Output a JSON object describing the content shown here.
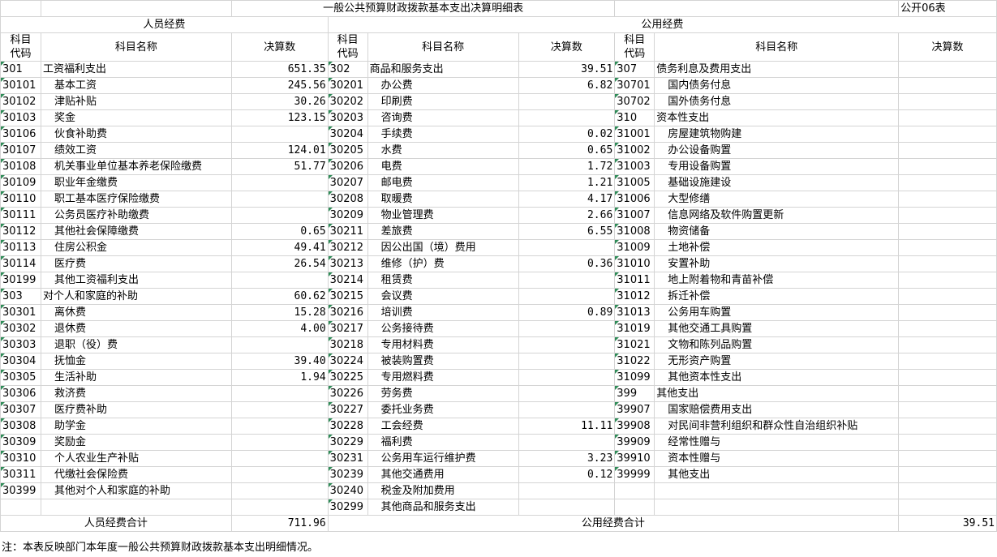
{
  "title": "一般公共预算财政拨款基本支出决算明细表",
  "code_tag": "公开06表",
  "groups": {
    "personnel": "人员经费",
    "public": "公用经费"
  },
  "headers": {
    "code_line1": "科目",
    "code_line2": "代码",
    "name": "科目名称",
    "amount": "决算数"
  },
  "rows": [
    {
      "c1": "301",
      "n1": "工资福利支出",
      "a1": "651.35",
      "c2": "302",
      "n2": "商品和服务支出",
      "a2": "39.51",
      "c3": "307",
      "n3": "债务利息及费用支出",
      "a3": ""
    },
    {
      "c1": "30101",
      "n1": "基本工资",
      "a1": "245.56",
      "c2": "30201",
      "n2": "办公费",
      "a2": "6.82",
      "c3": "30701",
      "n3": "国内债务付息",
      "a3": ""
    },
    {
      "c1": "30102",
      "n1": "津贴补贴",
      "a1": "30.26",
      "c2": "30202",
      "n2": "印刷费",
      "a2": "",
      "c3": "30702",
      "n3": "国外债务付息",
      "a3": ""
    },
    {
      "c1": "30103",
      "n1": "奖金",
      "a1": "123.15",
      "c2": "30203",
      "n2": "咨询费",
      "a2": "",
      "c3": "310",
      "n3": "资本性支出",
      "a3": ""
    },
    {
      "c1": "30106",
      "n1": "伙食补助费",
      "a1": "",
      "c2": "30204",
      "n2": "手续费",
      "a2": "0.02",
      "c3": "31001",
      "n3": "房屋建筑物购建",
      "a3": ""
    },
    {
      "c1": "30107",
      "n1": "绩效工资",
      "a1": "124.01",
      "c2": "30205",
      "n2": "水费",
      "a2": "0.65",
      "c3": "31002",
      "n3": "办公设备购置",
      "a3": ""
    },
    {
      "c1": "30108",
      "n1": "机关事业单位基本养老保险缴费",
      "a1": "51.77",
      "c2": "30206",
      "n2": "电费",
      "a2": "1.72",
      "c3": "31003",
      "n3": "专用设备购置",
      "a3": ""
    },
    {
      "c1": "30109",
      "n1": "职业年金缴费",
      "a1": "",
      "c2": "30207",
      "n2": "邮电费",
      "a2": "1.21",
      "c3": "31005",
      "n3": "基础设施建设",
      "a3": ""
    },
    {
      "c1": "30110",
      "n1": "职工基本医疗保险缴费",
      "a1": "",
      "c2": "30208",
      "n2": "取暖费",
      "a2": "4.17",
      "c3": "31006",
      "n3": "大型修缮",
      "a3": ""
    },
    {
      "c1": "30111",
      "n1": "公务员医疗补助缴费",
      "a1": "",
      "c2": "30209",
      "n2": "物业管理费",
      "a2": "2.66",
      "c3": "31007",
      "n3": "信息网络及软件购置更新",
      "a3": ""
    },
    {
      "c1": "30112",
      "n1": "其他社会保障缴费",
      "a1": "0.65",
      "c2": "30211",
      "n2": "差旅费",
      "a2": "6.55",
      "c3": "31008",
      "n3": "物资储备",
      "a3": ""
    },
    {
      "c1": "30113",
      "n1": "住房公积金",
      "a1": "49.41",
      "c2": "30212",
      "n2": "因公出国（境）费用",
      "a2": "",
      "c3": "31009",
      "n3": "土地补偿",
      "a3": ""
    },
    {
      "c1": "30114",
      "n1": "医疗费",
      "a1": "26.54",
      "c2": "30213",
      "n2": "维修（护）费",
      "a2": "0.36",
      "c3": "31010",
      "n3": "安置补助",
      "a3": ""
    },
    {
      "c1": "30199",
      "n1": "其他工资福利支出",
      "a1": "",
      "c2": "30214",
      "n2": "租赁费",
      "a2": "",
      "c3": "31011",
      "n3": "地上附着物和青苗补偿",
      "a3": ""
    },
    {
      "c1": "303",
      "n1": "对个人和家庭的补助",
      "a1": "60.62",
      "c2": "30215",
      "n2": "会议费",
      "a2": "",
      "c3": "31012",
      "n3": "拆迁补偿",
      "a3": ""
    },
    {
      "c1": "30301",
      "n1": "离休费",
      "a1": "15.28",
      "c2": "30216",
      "n2": "培训费",
      "a2": "0.89",
      "c3": "31013",
      "n3": "公务用车购置",
      "a3": ""
    },
    {
      "c1": "30302",
      "n1": "退休费",
      "a1": "4.00",
      "c2": "30217",
      "n2": "公务接待费",
      "a2": "",
      "c3": "31019",
      "n3": "其他交通工具购置",
      "a3": ""
    },
    {
      "c1": "30303",
      "n1": "退职（役）费",
      "a1": "",
      "c2": "30218",
      "n2": "专用材料费",
      "a2": "",
      "c3": "31021",
      "n3": "文物和陈列品购置",
      "a3": ""
    },
    {
      "c1": "30304",
      "n1": "抚恤金",
      "a1": "39.40",
      "c2": "30224",
      "n2": "被装购置费",
      "a2": "",
      "c3": "31022",
      "n3": "无形资产购置",
      "a3": ""
    },
    {
      "c1": "30305",
      "n1": "生活补助",
      "a1": "1.94",
      "c2": "30225",
      "n2": "专用燃料费",
      "a2": "",
      "c3": "31099",
      "n3": "其他资本性支出",
      "a3": ""
    },
    {
      "c1": "30306",
      "n1": "救济费",
      "a1": "",
      "c2": "30226",
      "n2": "劳务费",
      "a2": "",
      "c3": "399",
      "n3": "其他支出",
      "a3": ""
    },
    {
      "c1": "30307",
      "n1": "医疗费补助",
      "a1": "",
      "c2": "30227",
      "n2": "委托业务费",
      "a2": "",
      "c3": "39907",
      "n3": "国家赔偿费用支出",
      "a3": ""
    },
    {
      "c1": "30308",
      "n1": "助学金",
      "a1": "",
      "c2": "30228",
      "n2": "工会经费",
      "a2": "11.11",
      "c3": "39908",
      "n3": "对民间非营利组织和群众性自治组织补贴",
      "a3": ""
    },
    {
      "c1": "30309",
      "n1": "奖励金",
      "a1": "",
      "c2": "30229",
      "n2": "福利费",
      "a2": "",
      "c3": "39909",
      "n3": "经常性赠与",
      "a3": ""
    },
    {
      "c1": "30310",
      "n1": "个人农业生产补贴",
      "a1": "",
      "c2": "30231",
      "n2": "公务用车运行维护费",
      "a2": "3.23",
      "c3": "39910",
      "n3": "资本性赠与",
      "a3": ""
    },
    {
      "c1": "30311",
      "n1": "代缴社会保险费",
      "a1": "",
      "c2": "30239",
      "n2": "其他交通费用",
      "a2": "0.12",
      "c3": "39999",
      "n3": "其他支出",
      "a3": ""
    },
    {
      "c1": "30399",
      "n1": "其他对个人和家庭的补助",
      "a1": "",
      "c2": "30240",
      "n2": "税金及附加费用",
      "a2": "",
      "c3": "",
      "n3": "",
      "a3": ""
    },
    {
      "c1": "",
      "n1": "",
      "a1": "",
      "c2": "30299",
      "n2": "其他商品和服务支出",
      "a2": "",
      "c3": "",
      "n3": "",
      "a3": ""
    }
  ],
  "totals": {
    "personnel_label": "人员经费合计",
    "personnel_value": "711.96",
    "public_label": "公用经费合计",
    "public_value": "39.51"
  },
  "note": "注：本表反映部门本年度一般公共预算财政拨款基本支出明细情况。"
}
